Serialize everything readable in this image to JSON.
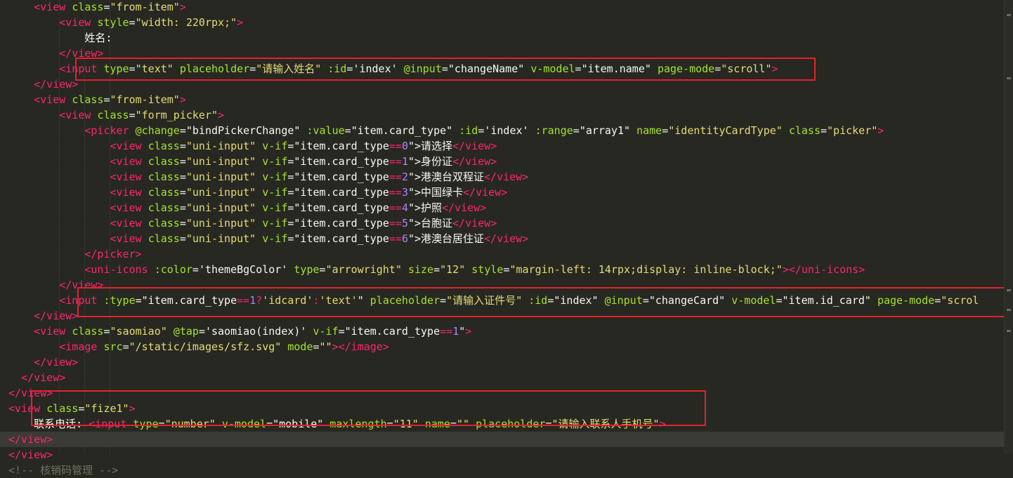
{
  "editor": {
    "lines": [
      [
        [
          "tok-text",
          "    "
        ],
        [
          "tok-tag",
          "<view"
        ],
        [
          "tok-text",
          " "
        ],
        [
          "tok-attr",
          "class"
        ],
        [
          "tok-text",
          "="
        ],
        [
          "tok-str",
          "\"from-item\""
        ],
        [
          "tok-tag",
          ">"
        ]
      ],
      [
        [
          "tok-text",
          "        "
        ],
        [
          "tok-tag",
          "<view"
        ],
        [
          "tok-text",
          " "
        ],
        [
          "tok-attr",
          "style"
        ],
        [
          "tok-text",
          "="
        ],
        [
          "tok-str",
          "\"width: 220rpx;\""
        ],
        [
          "tok-tag",
          ">"
        ]
      ],
      [
        [
          "tok-text",
          "            姓名:"
        ]
      ],
      [
        [
          "tok-text",
          "        "
        ],
        [
          "tok-tag",
          "</view>"
        ]
      ],
      [
        [
          "tok-text",
          "        "
        ],
        [
          "tok-tag",
          "<input"
        ],
        [
          "tok-text",
          " "
        ],
        [
          "tok-attr",
          "type"
        ],
        [
          "tok-text",
          "="
        ],
        [
          "tok-str",
          "\"text\""
        ],
        [
          "tok-text",
          " "
        ],
        [
          "tok-attr",
          "placeholder"
        ],
        [
          "tok-text",
          "="
        ],
        [
          "tok-str",
          "\"请输入姓名\""
        ],
        [
          "tok-text",
          " "
        ],
        [
          "tok-attr",
          ":id"
        ],
        [
          "tok-text",
          "="
        ],
        [
          "tok-text",
          "'index'"
        ],
        [
          "tok-text",
          " "
        ],
        [
          "tok-attr",
          "@input"
        ],
        [
          "tok-text",
          "="
        ],
        [
          "tok-text",
          "\"changeName\""
        ],
        [
          "tok-text",
          " "
        ],
        [
          "tok-attr",
          "v-model"
        ],
        [
          "tok-text",
          "="
        ],
        [
          "tok-text",
          "\"item.name\""
        ],
        [
          "tok-text",
          " "
        ],
        [
          "tok-attr",
          "page-mode"
        ],
        [
          "tok-text",
          "="
        ],
        [
          "tok-str",
          "\"scroll\""
        ],
        [
          "tok-tag",
          ">"
        ]
      ],
      [
        [
          "tok-text",
          "    "
        ],
        [
          "tok-tag",
          "</view>"
        ]
      ],
      [
        [
          "tok-text",
          "    "
        ],
        [
          "tok-tag",
          "<view"
        ],
        [
          "tok-text",
          " "
        ],
        [
          "tok-attr",
          "class"
        ],
        [
          "tok-text",
          "="
        ],
        [
          "tok-str",
          "\"from-item\""
        ],
        [
          "tok-tag",
          ">"
        ]
      ],
      [
        [
          "tok-text",
          "        "
        ],
        [
          "tok-tag",
          "<view"
        ],
        [
          "tok-text",
          " "
        ],
        [
          "tok-attr",
          "class"
        ],
        [
          "tok-text",
          "="
        ],
        [
          "tok-str",
          "\"form_picker\""
        ],
        [
          "tok-tag",
          ">"
        ]
      ],
      [
        [
          "tok-text",
          "            "
        ],
        [
          "tok-tag",
          "<picker"
        ],
        [
          "tok-text",
          " "
        ],
        [
          "tok-attr",
          "@change"
        ],
        [
          "tok-text",
          "="
        ],
        [
          "tok-text",
          "\"bindPickerChange\""
        ],
        [
          "tok-text",
          " "
        ],
        [
          "tok-attr",
          ":value"
        ],
        [
          "tok-text",
          "="
        ],
        [
          "tok-text",
          "\"item.card_type\""
        ],
        [
          "tok-text",
          " "
        ],
        [
          "tok-attr",
          ":id"
        ],
        [
          "tok-text",
          "="
        ],
        [
          "tok-text",
          "'index'"
        ],
        [
          "tok-text",
          " "
        ],
        [
          "tok-attr",
          ":range"
        ],
        [
          "tok-text",
          "="
        ],
        [
          "tok-text",
          "\"array1\""
        ],
        [
          "tok-text",
          " "
        ],
        [
          "tok-attr",
          "name"
        ],
        [
          "tok-text",
          "="
        ],
        [
          "tok-str",
          "\"identityCardType\""
        ],
        [
          "tok-text",
          " "
        ],
        [
          "tok-attr",
          "class"
        ],
        [
          "tok-text",
          "="
        ],
        [
          "tok-str",
          "\"picker\""
        ],
        [
          "tok-tag",
          ">"
        ]
      ],
      [
        [
          "tok-text",
          "                "
        ],
        [
          "tok-tag",
          "<view"
        ],
        [
          "tok-text",
          " "
        ],
        [
          "tok-attr",
          "class"
        ],
        [
          "tok-text",
          "="
        ],
        [
          "tok-str",
          "\"uni-input\""
        ],
        [
          "tok-text",
          " "
        ],
        [
          "tok-attr",
          "v-if"
        ],
        [
          "tok-text",
          "="
        ],
        [
          "tok-text",
          "\"item.card_type"
        ],
        [
          "tok-tag",
          "=="
        ],
        [
          "tok-val",
          "0"
        ],
        [
          "tok-text",
          "\">请选择"
        ],
        [
          "tok-tag",
          "</view>"
        ]
      ],
      [
        [
          "tok-text",
          "                "
        ],
        [
          "tok-tag",
          "<view"
        ],
        [
          "tok-text",
          " "
        ],
        [
          "tok-attr",
          "class"
        ],
        [
          "tok-text",
          "="
        ],
        [
          "tok-str",
          "\"uni-input\""
        ],
        [
          "tok-text",
          " "
        ],
        [
          "tok-attr",
          "v-if"
        ],
        [
          "tok-text",
          "="
        ],
        [
          "tok-text",
          "\"item.card_type"
        ],
        [
          "tok-tag",
          "=="
        ],
        [
          "tok-val",
          "1"
        ],
        [
          "tok-text",
          "\">身份证"
        ],
        [
          "tok-tag",
          "</view>"
        ]
      ],
      [
        [
          "tok-text",
          "                "
        ],
        [
          "tok-tag",
          "<view"
        ],
        [
          "tok-text",
          " "
        ],
        [
          "tok-attr",
          "class"
        ],
        [
          "tok-text",
          "="
        ],
        [
          "tok-str",
          "\"uni-input\""
        ],
        [
          "tok-text",
          " "
        ],
        [
          "tok-attr",
          "v-if"
        ],
        [
          "tok-text",
          "="
        ],
        [
          "tok-text",
          "\"item.card_type"
        ],
        [
          "tok-tag",
          "=="
        ],
        [
          "tok-val",
          "2"
        ],
        [
          "tok-text",
          "\">港澳台双程证"
        ],
        [
          "tok-tag",
          "</view>"
        ]
      ],
      [
        [
          "tok-text",
          "                "
        ],
        [
          "tok-tag",
          "<view"
        ],
        [
          "tok-text",
          " "
        ],
        [
          "tok-attr",
          "class"
        ],
        [
          "tok-text",
          "="
        ],
        [
          "tok-str",
          "\"uni-input\""
        ],
        [
          "tok-text",
          " "
        ],
        [
          "tok-attr",
          "v-if"
        ],
        [
          "tok-text",
          "="
        ],
        [
          "tok-text",
          "\"item.card_type"
        ],
        [
          "tok-tag",
          "=="
        ],
        [
          "tok-val",
          "3"
        ],
        [
          "tok-text",
          "\">中国绿卡"
        ],
        [
          "tok-tag",
          "</view>"
        ]
      ],
      [
        [
          "tok-text",
          "                "
        ],
        [
          "tok-tag",
          "<view"
        ],
        [
          "tok-text",
          " "
        ],
        [
          "tok-attr",
          "class"
        ],
        [
          "tok-text",
          "="
        ],
        [
          "tok-str",
          "\"uni-input\""
        ],
        [
          "tok-text",
          " "
        ],
        [
          "tok-attr",
          "v-if"
        ],
        [
          "tok-text",
          "="
        ],
        [
          "tok-text",
          "\"item.card_type"
        ],
        [
          "tok-tag",
          "=="
        ],
        [
          "tok-val",
          "4"
        ],
        [
          "tok-text",
          "\">护照"
        ],
        [
          "tok-tag",
          "</view>"
        ]
      ],
      [
        [
          "tok-text",
          "                "
        ],
        [
          "tok-tag",
          "<view"
        ],
        [
          "tok-text",
          " "
        ],
        [
          "tok-attr",
          "class"
        ],
        [
          "tok-text",
          "="
        ],
        [
          "tok-str",
          "\"uni-input\""
        ],
        [
          "tok-text",
          " "
        ],
        [
          "tok-attr",
          "v-if"
        ],
        [
          "tok-text",
          "="
        ],
        [
          "tok-text",
          "\"item.card_type"
        ],
        [
          "tok-tag",
          "=="
        ],
        [
          "tok-val",
          "5"
        ],
        [
          "tok-text",
          "\">台胞证"
        ],
        [
          "tok-tag",
          "</view>"
        ]
      ],
      [
        [
          "tok-text",
          "                "
        ],
        [
          "tok-tag",
          "<view"
        ],
        [
          "tok-text",
          " "
        ],
        [
          "tok-attr",
          "class"
        ],
        [
          "tok-text",
          "="
        ],
        [
          "tok-str",
          "\"uni-input\""
        ],
        [
          "tok-text",
          " "
        ],
        [
          "tok-attr",
          "v-if"
        ],
        [
          "tok-text",
          "="
        ],
        [
          "tok-text",
          "\"item.card_type"
        ],
        [
          "tok-tag",
          "=="
        ],
        [
          "tok-val",
          "6"
        ],
        [
          "tok-text",
          "\">港澳台居住证"
        ],
        [
          "tok-tag",
          "</view>"
        ]
      ],
      [
        [
          "tok-text",
          "            "
        ],
        [
          "tok-tag",
          "</picker>"
        ]
      ],
      [
        [
          "tok-text",
          "            "
        ],
        [
          "tok-tag",
          "<uni-icons"
        ],
        [
          "tok-text",
          " "
        ],
        [
          "tok-attr",
          ":color"
        ],
        [
          "tok-text",
          "="
        ],
        [
          "tok-text",
          "'themeBgColor'"
        ],
        [
          "tok-text",
          " "
        ],
        [
          "tok-attr",
          "type"
        ],
        [
          "tok-text",
          "="
        ],
        [
          "tok-str",
          "\"arrowright\""
        ],
        [
          "tok-text",
          " "
        ],
        [
          "tok-attr",
          "size"
        ],
        [
          "tok-text",
          "="
        ],
        [
          "tok-str",
          "\"12\""
        ],
        [
          "tok-text",
          " "
        ],
        [
          "tok-attr",
          "style"
        ],
        [
          "tok-text",
          "="
        ],
        [
          "tok-str",
          "\"margin-left: 14rpx;display: inline-block;\""
        ],
        [
          "tok-tag",
          "></uni-icons>"
        ]
      ],
      [
        [
          "tok-text",
          "        "
        ],
        [
          "tok-tag",
          "</view>"
        ]
      ],
      [
        [
          "tok-text",
          "        "
        ],
        [
          "tok-tag",
          "<input"
        ],
        [
          "tok-text",
          " "
        ],
        [
          "tok-attr",
          ":type"
        ],
        [
          "tok-text",
          "="
        ],
        [
          "tok-text",
          "\"item.card_type"
        ],
        [
          "tok-tag",
          "=="
        ],
        [
          "tok-val",
          "1"
        ],
        [
          "tok-tag",
          "?"
        ],
        [
          "tok-str",
          "'idcard'"
        ],
        [
          "tok-tag",
          ":"
        ],
        [
          "tok-str",
          "'text'"
        ],
        [
          "tok-text",
          "\""
        ],
        [
          "tok-text",
          " "
        ],
        [
          "tok-attr",
          "placeholder"
        ],
        [
          "tok-text",
          "="
        ],
        [
          "tok-str",
          "\"请输入证件号\""
        ],
        [
          "tok-text",
          " "
        ],
        [
          "tok-attr",
          ":id"
        ],
        [
          "tok-text",
          "="
        ],
        [
          "tok-text",
          "\"index\""
        ],
        [
          "tok-text",
          " "
        ],
        [
          "tok-attr",
          "@input"
        ],
        [
          "tok-text",
          "="
        ],
        [
          "tok-text",
          "\"changeCard\""
        ],
        [
          "tok-text",
          " "
        ],
        [
          "tok-attr",
          "v-model"
        ],
        [
          "tok-text",
          "="
        ],
        [
          "tok-text",
          "\"item.id_card\""
        ],
        [
          "tok-text",
          " "
        ],
        [
          "tok-attr",
          "page-mode"
        ],
        [
          "tok-text",
          "="
        ],
        [
          "tok-str",
          "\"scrol"
        ]
      ],
      [
        [
          "tok-text",
          "    "
        ],
        [
          "tok-tag",
          "</view>"
        ]
      ],
      [
        [
          "tok-text",
          "    "
        ],
        [
          "tok-tag",
          "<view"
        ],
        [
          "tok-text",
          " "
        ],
        [
          "tok-attr",
          "class"
        ],
        [
          "tok-text",
          "="
        ],
        [
          "tok-str",
          "\"saomiao\""
        ],
        [
          "tok-text",
          " "
        ],
        [
          "tok-attr",
          "@tap"
        ],
        [
          "tok-text",
          "="
        ],
        [
          "tok-text",
          "'saomiao(index)'"
        ],
        [
          "tok-text",
          " "
        ],
        [
          "tok-attr",
          "v-if"
        ],
        [
          "tok-text",
          "="
        ],
        [
          "tok-text",
          "\"item.card_type"
        ],
        [
          "tok-tag",
          "=="
        ],
        [
          "tok-val",
          "1"
        ],
        [
          "tok-text",
          "\""
        ],
        [
          "tok-tag",
          ">"
        ]
      ],
      [
        [
          "tok-text",
          "        "
        ],
        [
          "tok-tag",
          "<image"
        ],
        [
          "tok-text",
          " "
        ],
        [
          "tok-attr",
          "src"
        ],
        [
          "tok-text",
          "="
        ],
        [
          "tok-str",
          "\"/static/images/sfz.svg\""
        ],
        [
          "tok-text",
          " "
        ],
        [
          "tok-attr",
          "mode"
        ],
        [
          "tok-text",
          "="
        ],
        [
          "tok-str",
          "\"\""
        ],
        [
          "tok-tag",
          "></image>"
        ]
      ],
      [
        [
          "tok-text",
          "    "
        ],
        [
          "tok-tag",
          "</view>"
        ]
      ],
      [
        [
          "tok-text",
          "  "
        ],
        [
          "tok-tag",
          "</view>"
        ]
      ],
      [
        [
          "tok-tag",
          "</view>"
        ]
      ],
      [
        [
          "tok-tag",
          "<view"
        ],
        [
          "tok-text",
          " "
        ],
        [
          "tok-attr",
          "class"
        ],
        [
          "tok-text",
          "="
        ],
        [
          "tok-str",
          "\"fize1\""
        ],
        [
          "tok-tag",
          ">"
        ]
      ],
      [
        [
          "tok-text",
          "    联系电话: "
        ],
        [
          "tok-tag",
          "<input"
        ],
        [
          "tok-text",
          " "
        ],
        [
          "tok-attr",
          "type"
        ],
        [
          "tok-text",
          "="
        ],
        [
          "tok-str",
          "\"number\""
        ],
        [
          "tok-text",
          " "
        ],
        [
          "tok-attr",
          "v-model"
        ],
        [
          "tok-text",
          "="
        ],
        [
          "tok-text",
          "\"mobile\""
        ],
        [
          "tok-text",
          " "
        ],
        [
          "tok-attr",
          "maxlength"
        ],
        [
          "tok-text",
          "="
        ],
        [
          "tok-str",
          "\"11\""
        ],
        [
          "tok-text",
          " "
        ],
        [
          "tok-attr",
          "name"
        ],
        [
          "tok-text",
          "="
        ],
        [
          "tok-str",
          "\"\""
        ],
        [
          "tok-text",
          " "
        ],
        [
          "tok-attr",
          "placeholder"
        ],
        [
          "tok-text",
          "="
        ],
        [
          "tok-str",
          "\"请输入联系人手机号\""
        ],
        [
          "tok-tag",
          ">"
        ]
      ],
      [
        [
          "tok-tag",
          "</view>"
        ]
      ],
      [
        [
          "tok-tag",
          "</view>"
        ]
      ],
      [
        [
          "tok-comment",
          "<!-- 核销码管理 -->"
        ]
      ]
    ]
  }
}
